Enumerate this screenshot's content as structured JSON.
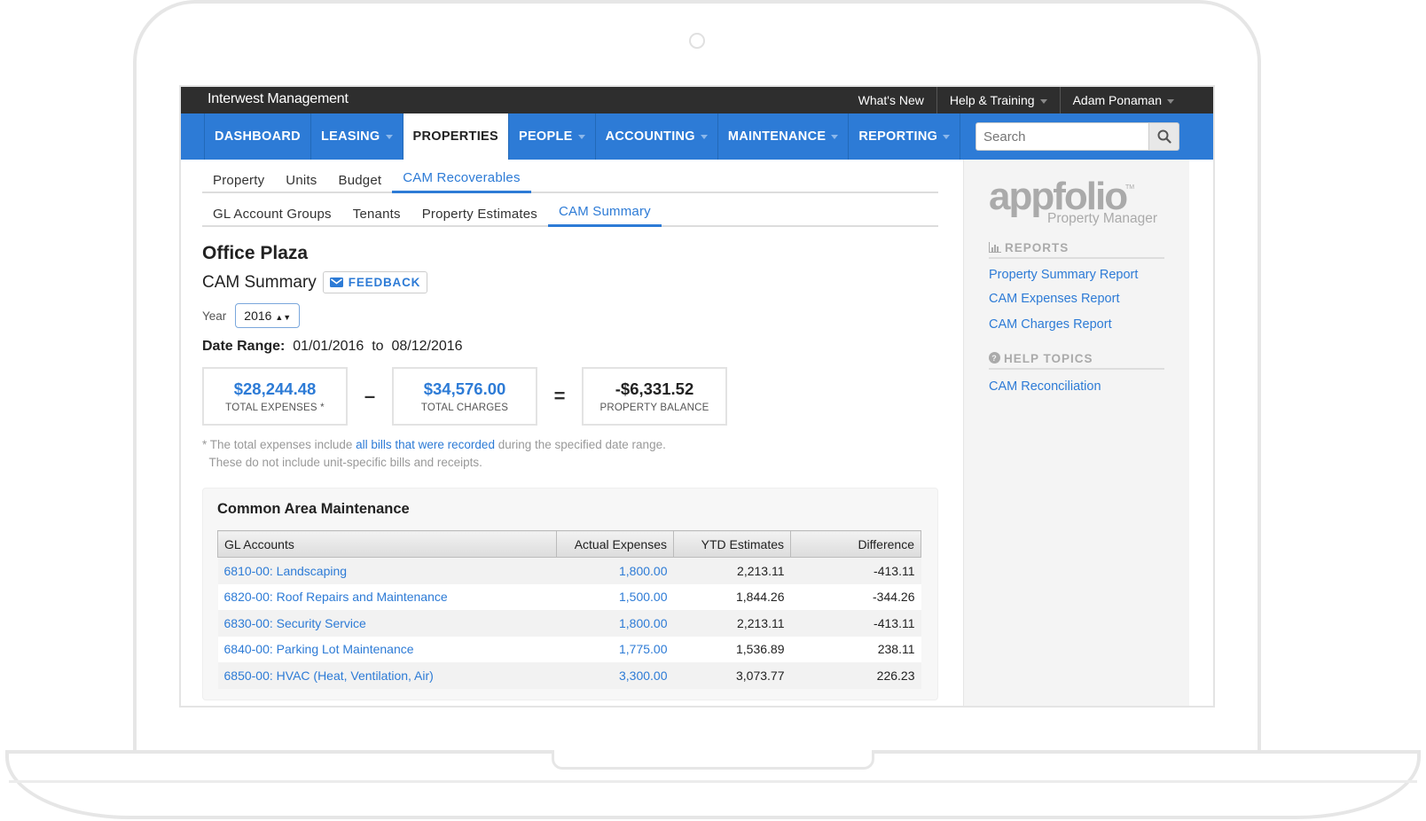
{
  "app": {
    "brand": "Interwest Management",
    "top_nav": [
      {
        "label": "What's New",
        "dropdown": false
      },
      {
        "label": "Help & Training",
        "dropdown": true
      },
      {
        "label": "Adam Ponaman",
        "dropdown": true
      }
    ]
  },
  "main_nav": [
    {
      "label": "DASHBOARD",
      "dropdown": false,
      "active": false
    },
    {
      "label": "LEASING",
      "dropdown": true,
      "active": false
    },
    {
      "label": "PROPERTIES",
      "dropdown": false,
      "active": true
    },
    {
      "label": "PEOPLE",
      "dropdown": true,
      "active": false
    },
    {
      "label": "ACCOUNTING",
      "dropdown": true,
      "active": false
    },
    {
      "label": "MAINTENANCE",
      "dropdown": true,
      "active": false
    },
    {
      "label": "REPORTING",
      "dropdown": true,
      "active": false
    }
  ],
  "search": {
    "placeholder": "Search",
    "icon": "search-icon"
  },
  "tabs": [
    {
      "label": "Property",
      "active": false
    },
    {
      "label": "Units",
      "active": false
    },
    {
      "label": "Budget",
      "active": false
    },
    {
      "label": "CAM Recoverables",
      "active": true
    }
  ],
  "subtabs": [
    {
      "label": "GL Account Groups",
      "active": false
    },
    {
      "label": "Tenants",
      "active": false
    },
    {
      "label": "Property Estimates",
      "active": false
    },
    {
      "label": "CAM Summary",
      "active": true
    }
  ],
  "page": {
    "title": "Office Plaza",
    "subtitle": "CAM Summary",
    "feedback_label": "FEEDBACK",
    "year_label": "Year",
    "year_value": "2016",
    "date_range_label": "Date Range:",
    "date_from": "01/01/2016",
    "date_to_word": "to",
    "date_to": "08/12/2016"
  },
  "summary": {
    "total_expenses": {
      "value": "$28,244.48",
      "label": "TOTAL EXPENSES *"
    },
    "minus": "–",
    "total_charges": {
      "value": "$34,576.00",
      "label": "TOTAL CHARGES"
    },
    "equals": "=",
    "property_balance": {
      "value": "-$6,331.52",
      "label": "PROPERTY BALANCE"
    }
  },
  "note": {
    "prefix": "* The total expenses include ",
    "link": "all bills that were recorded",
    "suffix": " during the specified date range.",
    "line2": "These do not include unit-specific bills and receipts."
  },
  "cam_table": {
    "title": "Common Area Maintenance",
    "columns": [
      "GL Accounts",
      "Actual Expenses",
      "YTD Estimates",
      "Difference"
    ],
    "rows": [
      {
        "account": "6810-00: Landscaping",
        "actual": "1,800.00",
        "ytd": "2,213.11",
        "diff": "-413.11"
      },
      {
        "account": "6820-00: Roof Repairs and Maintenance",
        "actual": "1,500.00",
        "ytd": "1,844.26",
        "diff": "-344.26"
      },
      {
        "account": "6830-00: Security Service",
        "actual": "1,800.00",
        "ytd": "2,213.11",
        "diff": "-413.11"
      },
      {
        "account": "6840-00: Parking Lot Maintenance",
        "actual": "1,775.00",
        "ytd": "1,536.89",
        "diff": "238.11"
      },
      {
        "account": "6850-00: HVAC (Heat, Ventilation, Air)",
        "actual": "3,300.00",
        "ytd": "3,073.77",
        "diff": "226.23"
      }
    ]
  },
  "sidebar": {
    "logo": {
      "name": "appfolio",
      "tm": "TM",
      "tagline": "Property Manager"
    },
    "reports_heading": "REPORTS",
    "reports": [
      "Property Summary Report",
      "CAM Expenses Report",
      "CAM Charges Report"
    ],
    "help_heading": "HELP TOPICS",
    "help": [
      "CAM Reconciliation"
    ]
  },
  "colors": {
    "accent": "#2d7bd6",
    "topbar": "#2e2e2e",
    "text": "#222222",
    "muted": "#999999"
  }
}
